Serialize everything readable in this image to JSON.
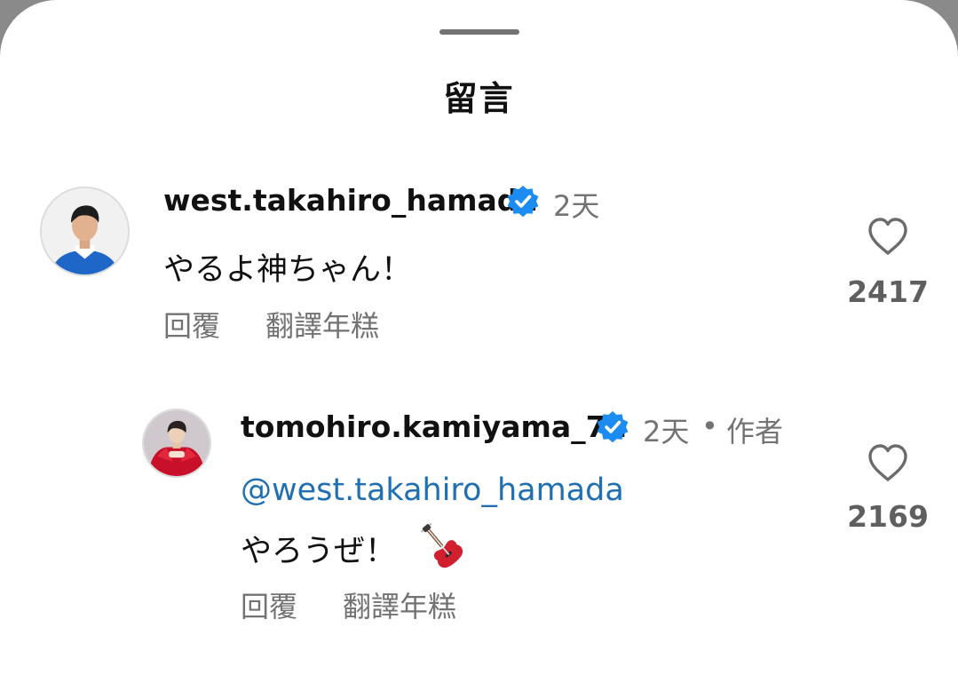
{
  "sheet": {
    "title": "留言"
  },
  "comments": [
    {
      "username": "west.takahiro_hamada",
      "verified": true,
      "time": "2天",
      "text": "やるよ神ちゃん！",
      "reply_label": "回覆",
      "translate_label": "翻譯年糕",
      "likes": "2417"
    },
    {
      "username": "tomohiro.kamiyama_71",
      "verified": true,
      "time": "2天",
      "separator": "•",
      "author_badge": "作者",
      "mention": "@west.takahiro_hamada",
      "text": "やろうぜ！",
      "emoji": "guitar-icon",
      "reply_label": "回覆",
      "translate_label": "翻譯年糕",
      "likes": "2169"
    }
  ],
  "icons": {
    "verified": "verified-badge-icon",
    "like": "heart-icon"
  },
  "colors": {
    "verified_blue": "#1d8cf2",
    "mention_blue": "#1f6fb2",
    "text_primary": "#111111",
    "text_secondary": "#737373",
    "backdrop": "#8a8a8a"
  }
}
